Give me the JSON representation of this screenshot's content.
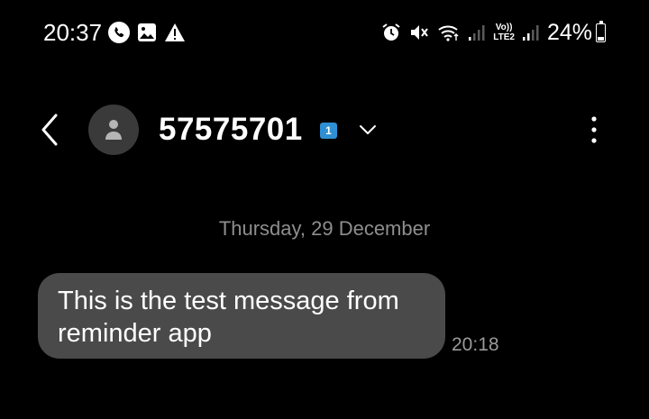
{
  "status_bar": {
    "time": "20:37",
    "left_icons": [
      "phone-call-icon",
      "image-icon",
      "warning-icon"
    ],
    "right_icons": [
      "alarm-icon",
      "mute-icon",
      "wifi-icon",
      "signal-icon",
      "signal-icon"
    ],
    "volte_line1": "Vo))",
    "volte_line2": "LTE2",
    "battery_percent": "24%",
    "battery_level": 0.24
  },
  "header": {
    "back_icon": "chevron-left-icon",
    "avatar_icon": "person-icon",
    "contact_name": "57575701",
    "sim_badge": "1",
    "expand_icon": "chevron-down-icon",
    "more_icon": "more-vertical-icon"
  },
  "conversation": {
    "date_separator": "Thursday, 29 December",
    "messages": [
      {
        "text": "This is the test message from reminder app",
        "time": "20:18",
        "direction": "incoming"
      }
    ]
  },
  "colors": {
    "background": "#000000",
    "bubble": "#4a4a4a",
    "avatar": "#3a3a3a",
    "sim_badge": "#2f8fd4",
    "secondary_text": "#8e8e8e"
  }
}
